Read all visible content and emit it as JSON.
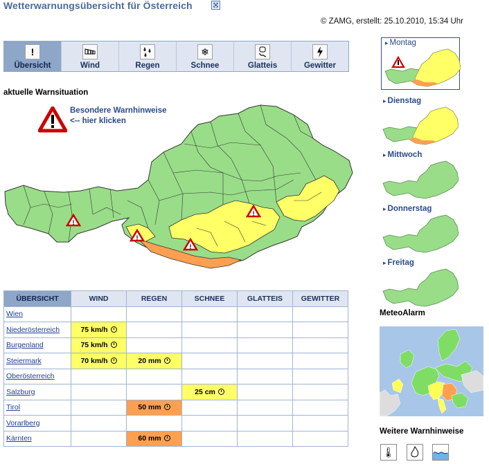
{
  "title": "Wetterwarnungsübersicht für Österreich",
  "copyright": "© ZAMG, erstellt: 25.10.2010, 15:34 Uhr",
  "tabs": [
    {
      "label": "Übersicht",
      "icon": "warning-exclamation-icon",
      "active": true
    },
    {
      "label": "Wind",
      "icon": "windsock-icon",
      "active": false
    },
    {
      "label": "Regen",
      "icon": "rain-drops-icon",
      "active": false
    },
    {
      "label": "Schnee",
      "icon": "snowflake-icon",
      "active": false
    },
    {
      "label": "Glatteis",
      "icon": "skidding-car-icon",
      "active": false
    },
    {
      "label": "Gewitter",
      "icon": "lightning-icon",
      "active": false
    }
  ],
  "warn_heading": "aktuelle Warnsituation",
  "special_hint": {
    "line1": "Besondere Warnhinweise",
    "line2": "<-- hier klicken"
  },
  "table": {
    "headers": [
      "ÜBERSICHT",
      "WIND",
      "REGEN",
      "SCHNEE",
      "GLATTEIS",
      "GEWITTER"
    ],
    "rows": [
      {
        "region": "Wien",
        "cells": [
          "",
          "",
          "",
          "",
          ""
        ]
      },
      {
        "region": "Niederösterreich",
        "cells": [
          "75 km/h",
          "",
          "",
          "",
          ""
        ]
      },
      {
        "region": "Burgenland",
        "cells": [
          "75 km/h",
          "",
          "",
          "",
          ""
        ]
      },
      {
        "region": "Steiermark",
        "cells": [
          "70 km/h",
          "20 mm",
          "",
          "",
          ""
        ]
      },
      {
        "region": "Oberösterreich",
        "cells": [
          "",
          "",
          "",
          "",
          ""
        ]
      },
      {
        "region": "Salzburg",
        "cells": [
          "",
          "",
          "25 cm",
          "",
          ""
        ]
      },
      {
        "region": "Tirol",
        "cells": [
          "",
          "50 mm",
          "",
          "",
          ""
        ]
      },
      {
        "region": "Vorarlberg",
        "cells": [
          "",
          "",
          "",
          "",
          ""
        ]
      },
      {
        "region": "Kärnten",
        "cells": [
          "",
          "60 mm",
          "",
          "",
          ""
        ]
      }
    ],
    "levels": [
      [
        "",
        "",
        "",
        "",
        ""
      ],
      [
        "yellow",
        "",
        "",
        "",
        ""
      ],
      [
        "yellow",
        "",
        "",
        "",
        ""
      ],
      [
        "yellow",
        "yellow",
        "",
        "",
        ""
      ],
      [
        "",
        "",
        "",
        "",
        ""
      ],
      [
        "",
        "",
        "yellow",
        "",
        ""
      ],
      [
        "",
        "orange",
        "",
        "",
        ""
      ],
      [
        "",
        "",
        "",
        "",
        ""
      ],
      [
        "",
        "orange",
        "",
        "",
        ""
      ]
    ]
  },
  "days": [
    {
      "label": "Montag",
      "selected": true,
      "level": "orange"
    },
    {
      "label": "Dienstag",
      "selected": false,
      "level": "orange"
    },
    {
      "label": "Mittwoch",
      "selected": false,
      "level": "green"
    },
    {
      "label": "Donnerstag",
      "selected": false,
      "level": "green"
    },
    {
      "label": "Freitag",
      "selected": false,
      "level": "green"
    }
  ],
  "meteoalarm_title": "MeteoAlarm",
  "more_title": "Weitere Warnhinweise",
  "more_icons": [
    "thermometer-icon",
    "fire-icon",
    "flood-icon"
  ],
  "colors": {
    "green": "#99dd88",
    "yellow": "#ffff66",
    "orange": "#ffa050",
    "accent": "#8ea6c8",
    "link": "#1e3d8f"
  }
}
